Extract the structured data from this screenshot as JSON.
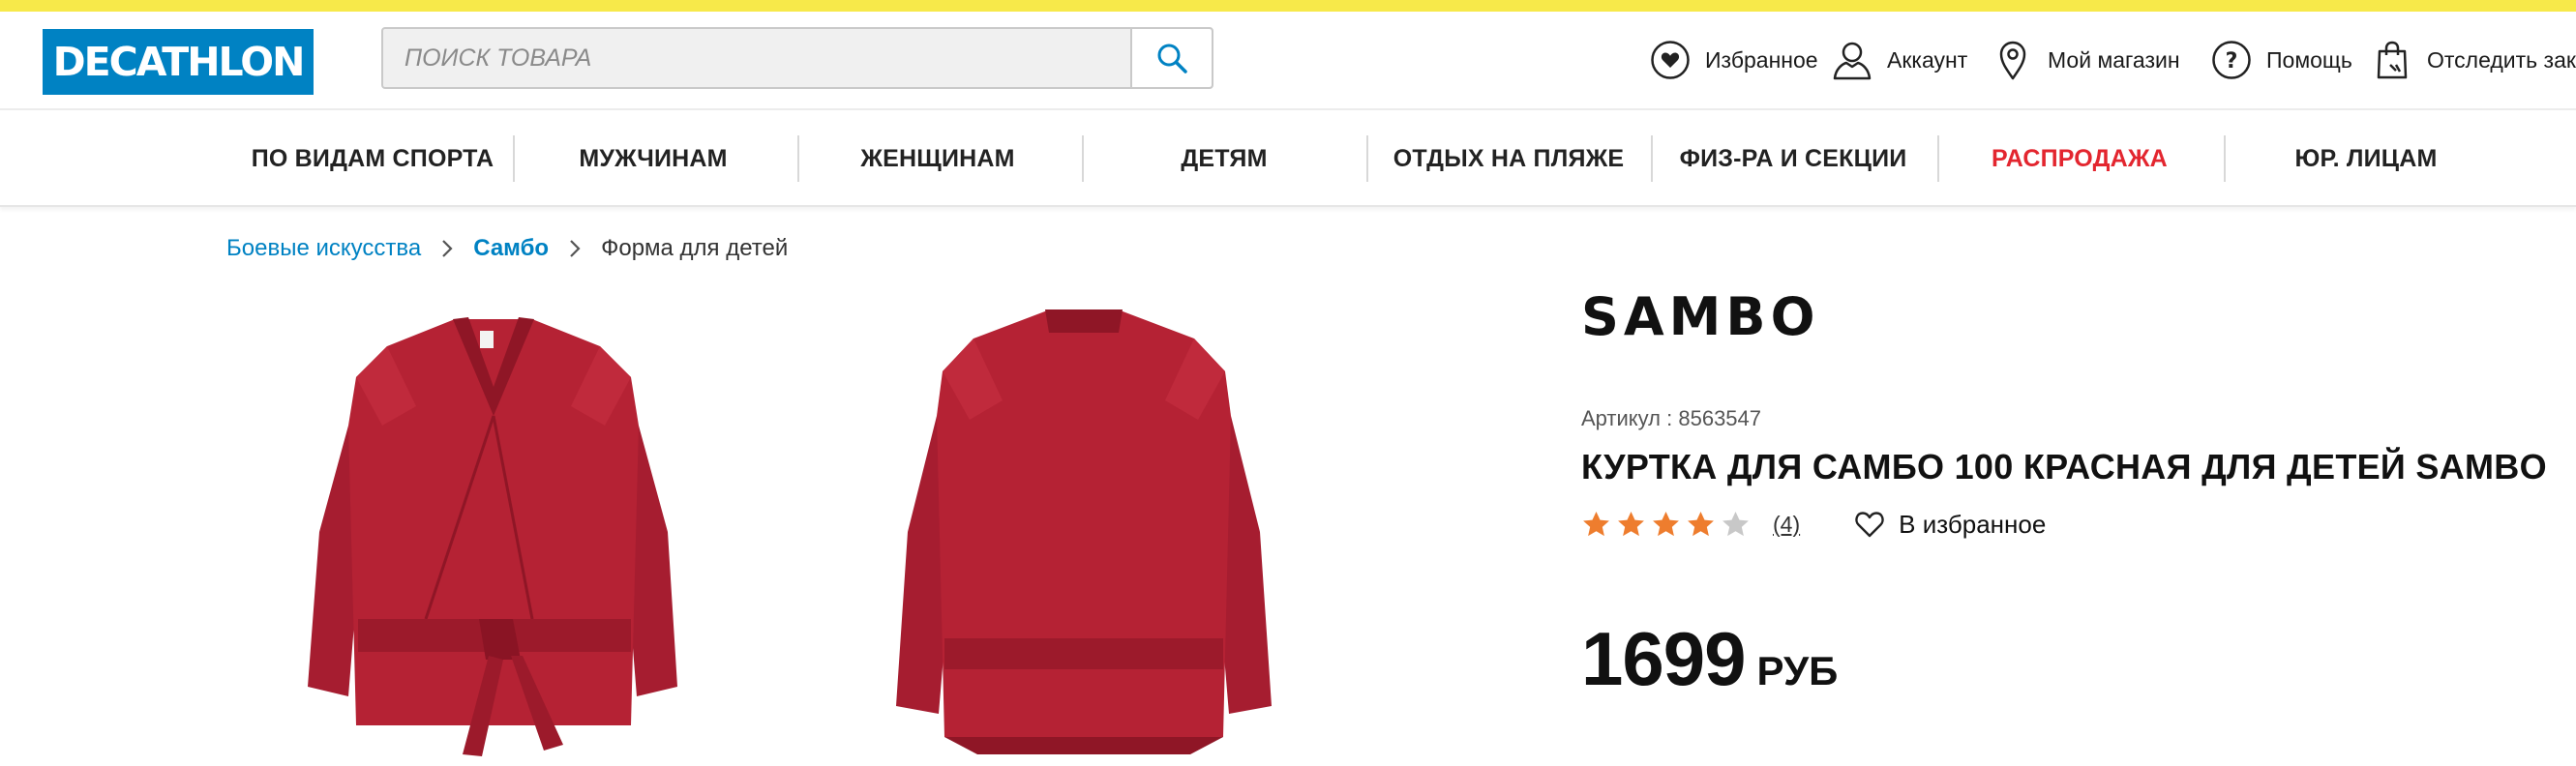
{
  "colors": {
    "accent": "#0082c3",
    "stripe": "#f7e94a",
    "sale": "#e3262f",
    "star": "#ee7d2e",
    "jacket": "#b52234"
  },
  "logo": {
    "text": "DECATHLON"
  },
  "search": {
    "placeholder": "ПОИСК ТОВАРА",
    "icon": "search-icon"
  },
  "header_links": [
    {
      "label": "Избранное",
      "icon": "heart-icon"
    },
    {
      "label": "Аккаунт",
      "icon": "user-icon"
    },
    {
      "label": "Мой магазин",
      "icon": "location-pin-icon"
    },
    {
      "label": "Помощь",
      "icon": "help-icon"
    },
    {
      "label": "Отследить заказ",
      "icon": "shopping-bag-icon"
    }
  ],
  "nav": [
    {
      "label": "ПО ВИДАМ СПОРТА"
    },
    {
      "label": "МУЖЧИНАМ"
    },
    {
      "label": "ЖЕНЩИНАМ"
    },
    {
      "label": "ДЕТЯМ"
    },
    {
      "label": "ОТДЫХ НА ПЛЯЖЕ"
    },
    {
      "label": "ФИЗ-РА И СЕКЦИИ"
    },
    {
      "label": "РАСПРОДАЖА"
    },
    {
      "label": "ЮР. ЛИЦАМ"
    }
  ],
  "breadcrumb": [
    {
      "label": "Боевые искусства"
    },
    {
      "label": "Самбо"
    },
    {
      "label": "Форма для детей"
    }
  ],
  "product": {
    "brand": "SAMBO",
    "article_label": "Артикул : ",
    "article_value": "8563547",
    "title": "КУРТКА ДЛЯ САМБО 100 КРАСНАЯ ДЛЯ ДЕТЕЙ SAMBO",
    "rating": 4,
    "rating_max": 5,
    "reviews": "(4)",
    "favorite_label": "В избранное",
    "price": "1699",
    "currency": "РУБ"
  }
}
